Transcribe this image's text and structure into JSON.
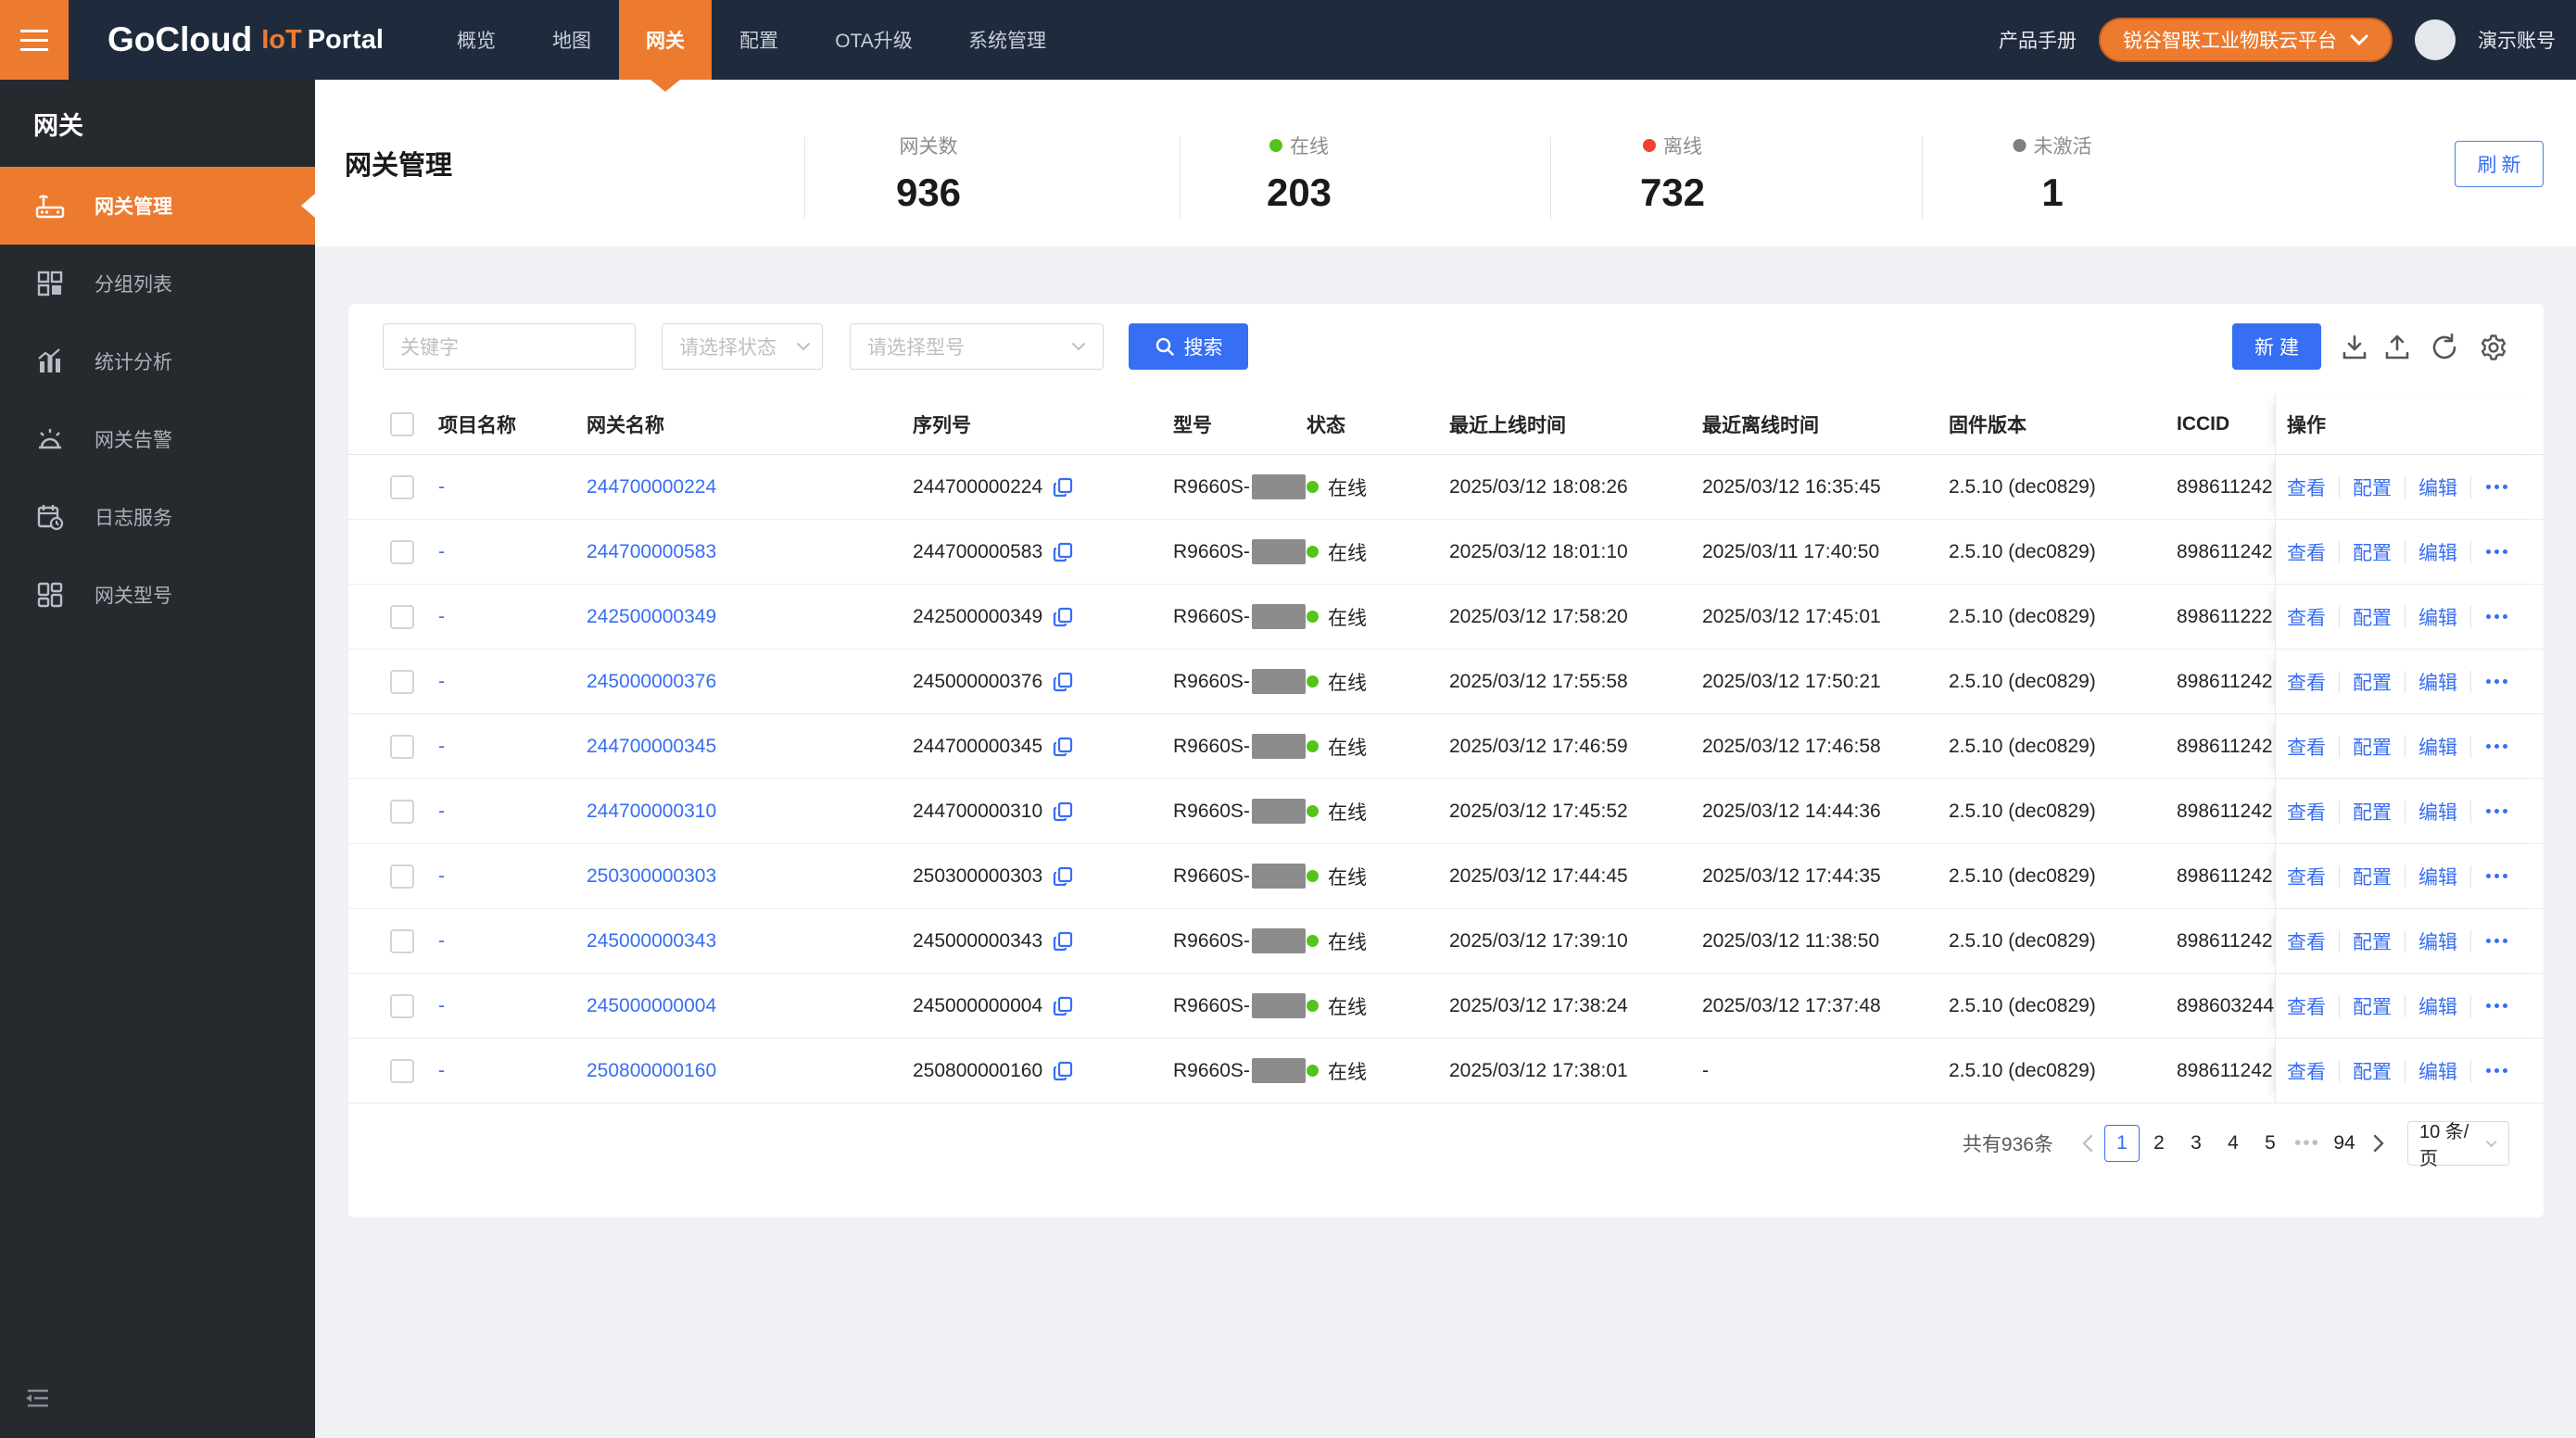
{
  "navbar": {
    "logo": {
      "part1": "GoCloud",
      "part2": "IoT",
      "part3": "Portal"
    },
    "items": [
      {
        "label": "概览"
      },
      {
        "label": "地图"
      },
      {
        "label": "网关"
      },
      {
        "label": "配置"
      },
      {
        "label": "OTA升级"
      },
      {
        "label": "系统管理"
      }
    ],
    "manual_label": "产品手册",
    "platform_label": "锐谷智联工业物联云平台",
    "account_label": "演示账号"
  },
  "sidebar": {
    "title": "网关",
    "items": [
      {
        "label": "网关管理"
      },
      {
        "label": "分组列表"
      },
      {
        "label": "统计分析"
      },
      {
        "label": "网关告警"
      },
      {
        "label": "日志服务"
      },
      {
        "label": "网关型号"
      }
    ]
  },
  "header": {
    "title": "网关管理",
    "stats": [
      {
        "label": "网关数",
        "value": "936"
      },
      {
        "label": "在线",
        "value": "203",
        "dot_color": "#52C41A"
      },
      {
        "label": "离线",
        "value": "732",
        "dot_color": "#F04134"
      },
      {
        "label": "未激活",
        "value": "1",
        "dot_color": "#7F7F7F"
      }
    ],
    "refresh_label": "刷新"
  },
  "toolbar": {
    "keyword_placeholder": "关键字",
    "status_placeholder": "请选择状态",
    "model_placeholder": "请选择型号",
    "search_label": "搜索",
    "create_label": "新建"
  },
  "table": {
    "headers": [
      "项目名称",
      "网关名称",
      "序列号",
      "型号",
      "状态",
      "最近上线时间",
      "最近离线时间",
      "固件版本",
      "ICCID",
      "操作"
    ],
    "model_prefix": "R9660S-",
    "status_online": "在线",
    "actions": {
      "view": "查看",
      "config": "配置",
      "edit": "编辑"
    },
    "rows": [
      {
        "project": "-",
        "name": "244700000224",
        "serial": "244700000224",
        "online": "2025/03/12 18:08:26",
        "offline": "2025/03/12 16:35:45",
        "firmware": "2.5.10 (dec0829)",
        "iccid": "898611242"
      },
      {
        "project": "-",
        "name": "244700000583",
        "serial": "244700000583",
        "online": "2025/03/12 18:01:10",
        "offline": "2025/03/11 17:40:50",
        "firmware": "2.5.10 (dec0829)",
        "iccid": "898611242"
      },
      {
        "project": "-",
        "name": "242500000349",
        "serial": "242500000349",
        "online": "2025/03/12 17:58:20",
        "offline": "2025/03/12 17:45:01",
        "firmware": "2.5.10 (dec0829)",
        "iccid": "898611222"
      },
      {
        "project": "-",
        "name": "245000000376",
        "serial": "245000000376",
        "online": "2025/03/12 17:55:58",
        "offline": "2025/03/12 17:50:21",
        "firmware": "2.5.10 (dec0829)",
        "iccid": "898611242"
      },
      {
        "project": "-",
        "name": "244700000345",
        "serial": "244700000345",
        "online": "2025/03/12 17:46:59",
        "offline": "2025/03/12 17:46:58",
        "firmware": "2.5.10 (dec0829)",
        "iccid": "898611242"
      },
      {
        "project": "-",
        "name": "244700000310",
        "serial": "244700000310",
        "online": "2025/03/12 17:45:52",
        "offline": "2025/03/12 14:44:36",
        "firmware": "2.5.10 (dec0829)",
        "iccid": "898611242"
      },
      {
        "project": "-",
        "name": "250300000303",
        "serial": "250300000303",
        "online": "2025/03/12 17:44:45",
        "offline": "2025/03/12 17:44:35",
        "firmware": "2.5.10 (dec0829)",
        "iccid": "898611242"
      },
      {
        "project": "-",
        "name": "245000000343",
        "serial": "245000000343",
        "online": "2025/03/12 17:39:10",
        "offline": "2025/03/12 11:38:50",
        "firmware": "2.5.10 (dec0829)",
        "iccid": "898611242"
      },
      {
        "project": "-",
        "name": "245000000004",
        "serial": "245000000004",
        "online": "2025/03/12 17:38:24",
        "offline": "2025/03/12 17:37:48",
        "firmware": "2.5.10 (dec0829)",
        "iccid": "898603244"
      },
      {
        "project": "-",
        "name": "250800000160",
        "serial": "250800000160",
        "online": "2025/03/12 17:38:01",
        "offline": "-",
        "firmware": "2.5.10 (dec0829)",
        "iccid": "898611242"
      }
    ]
  },
  "pagination": {
    "total_label": "共有936条",
    "pages": [
      "1",
      "2",
      "3",
      "4",
      "5"
    ],
    "ellipsis": "•••",
    "last_page": "94",
    "page_size": "10 条/页"
  }
}
